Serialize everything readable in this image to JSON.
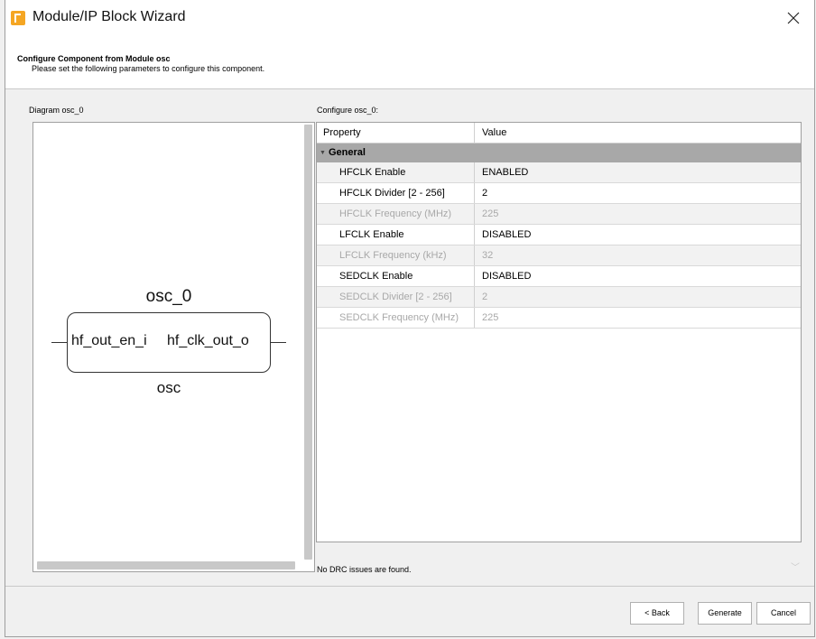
{
  "window": {
    "title": "Module/IP Block Wizard",
    "close_icon": "close-icon"
  },
  "header": {
    "title": "Configure Component from Module osc",
    "subtitle": "Please set the following parameters to configure this component."
  },
  "diagram": {
    "label": "Diagram osc_0",
    "instance_name": "osc_0",
    "port_in": "hf_out_en_i",
    "port_out": "hf_clk_out_o",
    "module_type": "osc"
  },
  "config": {
    "label": "Configure osc_0:",
    "columns": {
      "property": "Property",
      "value": "Value"
    },
    "group": "General",
    "rows": [
      {
        "property": "HFCLK Enable",
        "value": "ENABLED",
        "enabled": true
      },
      {
        "property": "HFCLK Divider  [2 - 256]",
        "value": "2",
        "enabled": true
      },
      {
        "property": "HFCLK Frequency (MHz)",
        "value": "225",
        "enabled": false
      },
      {
        "property": "LFCLK Enable",
        "value": "DISABLED",
        "enabled": true
      },
      {
        "property": "LFCLK Frequency (kHz)",
        "value": "32",
        "enabled": false
      },
      {
        "property": "SEDCLK Enable",
        "value": "DISABLED",
        "enabled": true
      },
      {
        "property": "SEDCLK Divider  [2 - 256]",
        "value": "2",
        "enabled": false
      },
      {
        "property": "SEDCLK Frequency (MHz)",
        "value": "225",
        "enabled": false
      }
    ]
  },
  "status": {
    "drc": "No DRC issues are found."
  },
  "buttons": {
    "back": "< Back",
    "generate": "Generate",
    "cancel": "Cancel"
  }
}
